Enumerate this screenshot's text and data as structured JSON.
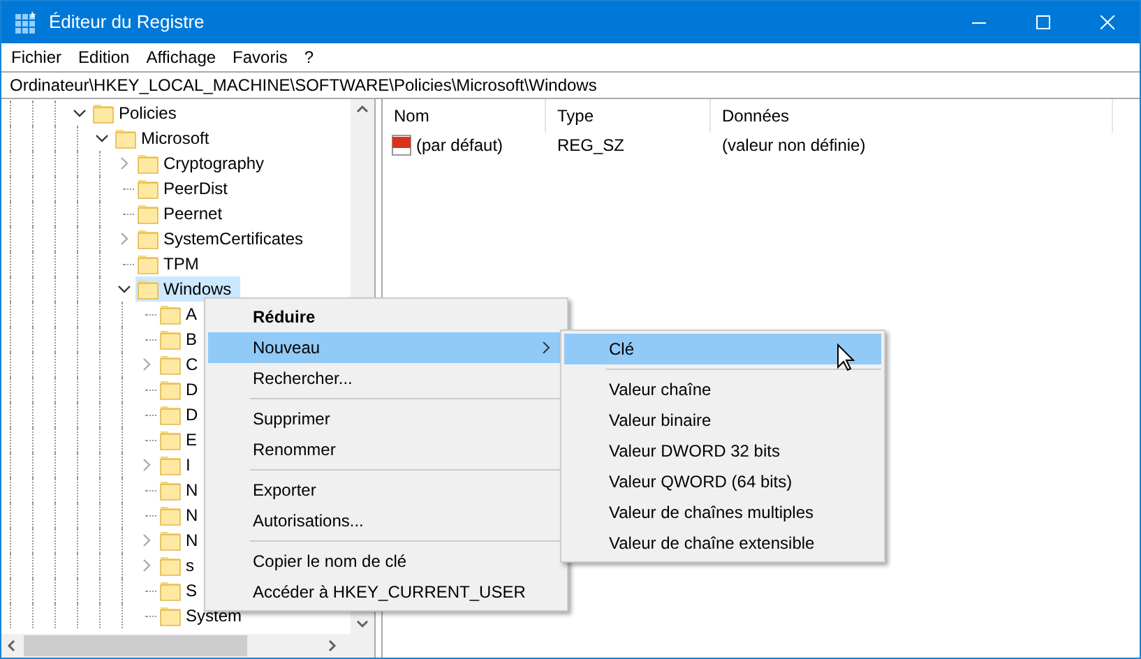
{
  "window": {
    "title": "Éditeur du Registre"
  },
  "menu_bar": [
    "Fichier",
    "Edition",
    "Affichage",
    "Favoris",
    "?"
  ],
  "address": "Ordinateur\\HKEY_LOCAL_MACHINE\\SOFTWARE\\Policies\\Microsoft\\Windows",
  "tree": [
    {
      "label": "Policies",
      "expanded": true,
      "selected": false,
      "children": [
        {
          "label": "Microsoft",
          "expanded": true,
          "selected": false,
          "children": [
            {
              "label": "Cryptography",
              "expanded": false,
              "selected": false
            },
            {
              "label": "PeerDist",
              "selected": false
            },
            {
              "label": "Peernet",
              "selected": false
            },
            {
              "label": "SystemCertificates",
              "expanded": false,
              "selected": false
            },
            {
              "label": "TPM",
              "selected": false
            },
            {
              "label": "Windows",
              "expanded": true,
              "selected": true,
              "children": [
                {
                  "label": "A",
                  "selected": false
                },
                {
                  "label": "B",
                  "selected": false
                },
                {
                  "label": "C",
                  "expanded": false,
                  "selected": false
                },
                {
                  "label": "D",
                  "selected": false
                },
                {
                  "label": "D",
                  "selected": false
                },
                {
                  "label": "E",
                  "selected": false
                },
                {
                  "label": "I",
                  "expanded": false,
                  "selected": false
                },
                {
                  "label": "N",
                  "selected": false
                },
                {
                  "label": "N",
                  "selected": false
                },
                {
                  "label": "N",
                  "expanded": false,
                  "selected": false
                },
                {
                  "label": "s",
                  "expanded": false,
                  "selected": false
                },
                {
                  "label": "S",
                  "selected": false
                },
                {
                  "label": "System",
                  "selected": false
                }
              ]
            }
          ]
        }
      ]
    }
  ],
  "table": {
    "columns": [
      "Nom",
      "Type",
      "Données"
    ],
    "rows": [
      {
        "name": "(par défaut)",
        "type": "REG_SZ",
        "data": "(valeur non définie)"
      }
    ]
  },
  "context_menu": {
    "items": [
      {
        "kind": "item",
        "label": "Réduire",
        "default": true,
        "selected": false
      },
      {
        "kind": "item",
        "label": "Nouveau",
        "selected": true,
        "submenu": true
      },
      {
        "kind": "item",
        "label": "Rechercher...",
        "selected": false
      },
      {
        "kind": "separator"
      },
      {
        "kind": "item",
        "label": "Supprimer",
        "selected": false
      },
      {
        "kind": "item",
        "label": "Renommer",
        "selected": false
      },
      {
        "kind": "separator"
      },
      {
        "kind": "item",
        "label": "Exporter",
        "selected": false
      },
      {
        "kind": "item",
        "label": "Autorisations...",
        "selected": false
      },
      {
        "kind": "separator"
      },
      {
        "kind": "item",
        "label": "Copier le nom de clé",
        "selected": false
      },
      {
        "kind": "item",
        "label": "Accéder à HKEY_CURRENT_USER",
        "selected": false
      }
    ]
  },
  "submenu": {
    "items": [
      {
        "kind": "item",
        "label": "Clé",
        "selected": true
      },
      {
        "kind": "separator"
      },
      {
        "kind": "item",
        "label": "Valeur chaîne",
        "selected": false
      },
      {
        "kind": "item",
        "label": "Valeur binaire",
        "selected": false
      },
      {
        "kind": "item",
        "label": "Valeur DWORD 32 bits",
        "selected": false
      },
      {
        "kind": "item",
        "label": "Valeur QWORD (64 bits)",
        "selected": false
      },
      {
        "kind": "item",
        "label": "Valeur de chaînes multiples",
        "selected": false
      },
      {
        "kind": "item",
        "label": "Valeur de chaîne extensible",
        "selected": false
      }
    ]
  }
}
